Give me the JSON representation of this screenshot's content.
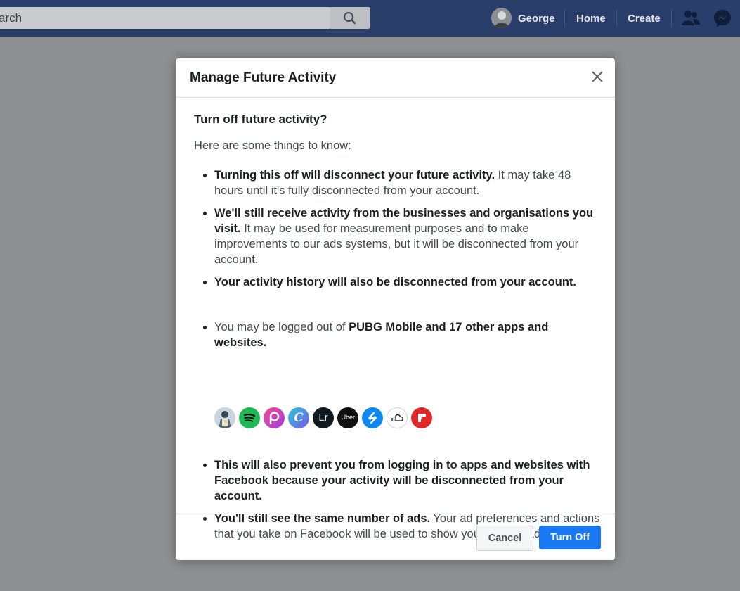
{
  "topbar": {
    "search_text": "arch",
    "user_name": "George",
    "nav_home": "Home",
    "nav_create": "Create"
  },
  "dialog": {
    "title": "Manage Future Activity",
    "question": "Turn off future activity?",
    "intro": "Here are some things to know:",
    "bullets": [
      {
        "bold": "Turning this off will disconnect your future activity.",
        "text": " It may take 48 hours until it's fully disconnected from your account."
      },
      {
        "bold": "We'll still receive activity from the businesses and organisations you visit.",
        "text": " It may be used for measurement purposes and to make improvements to our ads systems, but it will be disconnected from your account."
      },
      {
        "bold": "Your activity history will also be disconnected from your account.",
        "text": ""
      },
      {
        "text": "You may be logged out of ",
        "bold": "PUBG Mobile and 17 other apps and websites."
      },
      {
        "bold": "This will also prevent you from logging in to apps and websites with Facebook because your activity will be disconnected from your account.",
        "text": ""
      },
      {
        "bold": "You'll still see the same number of ads.",
        "text": " Your ad preferences and actions that you take on Facebook will be used to show you relevant ads."
      }
    ],
    "apps": [
      {
        "name": "pubg-icon",
        "color": "#9fb6c8",
        "glyph": ""
      },
      {
        "name": "spotify-icon",
        "color": "#1db954",
        "glyph": ""
      },
      {
        "name": "picsart-icon",
        "color": "#c33fc8",
        "glyph": "p"
      },
      {
        "name": "canva-icon",
        "color": "#3d8bdb",
        "glyph": "C"
      },
      {
        "name": "lightroom-icon",
        "color": "#101820",
        "glyph": "Lr"
      },
      {
        "name": "uber-icon",
        "color": "#111111",
        "glyph": "Uber"
      },
      {
        "name": "shazam-icon",
        "color": "#0f88f0",
        "glyph": "S"
      },
      {
        "name": "soundcloud-icon",
        "color": "#ffffff",
        "glyph": ""
      },
      {
        "name": "flipboard-icon",
        "color": "#e12828",
        "glyph": "f"
      }
    ],
    "cancel_label": "Cancel",
    "turn_off_label": "Turn Off"
  }
}
